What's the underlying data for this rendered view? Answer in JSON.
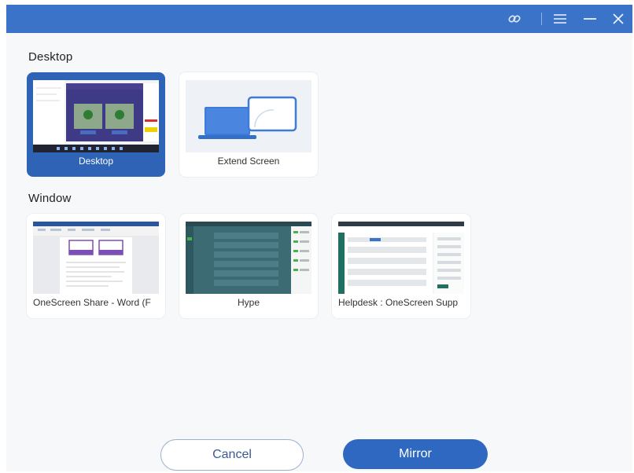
{
  "window": {
    "icons": [
      "link-icon",
      "menu-icon",
      "minimize-icon",
      "close-icon"
    ]
  },
  "sections": {
    "desktop": {
      "label": "Desktop",
      "items": [
        {
          "label": "Desktop",
          "selected": true
        },
        {
          "label": "Extend Screen",
          "selected": false
        }
      ]
    },
    "window": {
      "label": "Window",
      "items": [
        {
          "label": "OneScreen Share - Word (F"
        },
        {
          "label": "Hype"
        },
        {
          "label": "Helpdesk : OneScreen Supp"
        }
      ]
    }
  },
  "footer": {
    "cancel_label": "Cancel",
    "mirror_label": "Mirror"
  },
  "colors": {
    "titlebar": "#3b73c8",
    "selected_card": "#2f63b5",
    "primary_button": "#2f68c0"
  }
}
